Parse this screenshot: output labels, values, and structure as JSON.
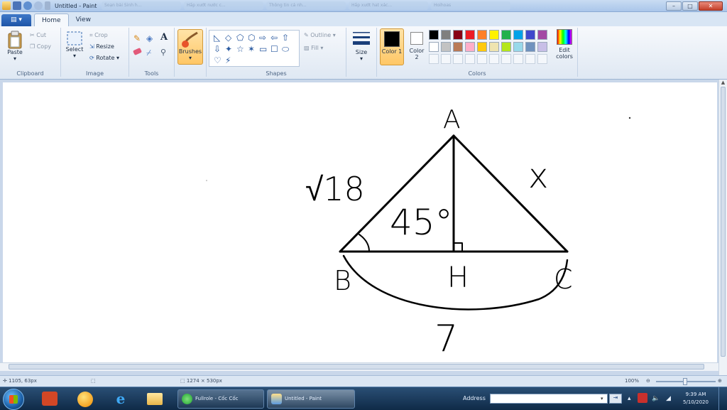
{
  "window": {
    "title": "Untitled - Paint"
  },
  "browser_tabs": [
    "Soạn bài Sinh h...",
    "Hấp xướt nước c...",
    "Thông tin cá nh...",
    "Hấp xướt hat xác...",
    "Hoihoas"
  ],
  "ribbon_tabs": {
    "file": "",
    "home": "Home",
    "view": "View"
  },
  "clipboard": {
    "paste": "Paste",
    "cut": "Cut",
    "copy": "Copy",
    "label": "Clipboard"
  },
  "image": {
    "select": "Select",
    "crop": "Crop",
    "resize": "Resize",
    "rotate": "Rotate",
    "label": "Image"
  },
  "tools": {
    "label": "Tools",
    "text_glyph": "A"
  },
  "brushes": {
    "label": "Brushes"
  },
  "shapes": {
    "outline": "Outline",
    "fill": "Fill",
    "label": "Shapes"
  },
  "size": {
    "label": "Size"
  },
  "colors": {
    "color1": "Color 1",
    "color2": "Color 2",
    "edit": "Edit colors",
    "label": "Colors",
    "color1_value": "#000000",
    "color2_value": "#ffffff",
    "row1": [
      "#000000",
      "#7f7f7f",
      "#880015",
      "#ed1c24",
      "#ff7f27",
      "#fff200",
      "#22b14c",
      "#00a2e8",
      "#3f48cc",
      "#a349a4"
    ],
    "row2": [
      "#ffffff",
      "#c3c3c3",
      "#b97a57",
      "#ffaec9",
      "#ffc90e",
      "#efe4b0",
      "#b5e61d",
      "#99d9ea",
      "#7092be",
      "#c8bfe7"
    ]
  },
  "drawing": {
    "vertex_a": "A",
    "vertex_b": "B",
    "vertex_c": "C",
    "foot_h": "H",
    "side_ab": "√18",
    "side_ac": "x",
    "side_bc": "7",
    "angle_b": "45°"
  },
  "status": {
    "cursor": "1105, 63px",
    "canvas_size": "1274 × 530px",
    "zoom": "100%"
  },
  "taskbar": {
    "task_browser": "Fullrole - Cốc Cốc",
    "task_paint": "Untitled - Paint",
    "address_label": "Address",
    "address_value": "",
    "time": "9:39 AM",
    "date": "5/10/2020"
  }
}
